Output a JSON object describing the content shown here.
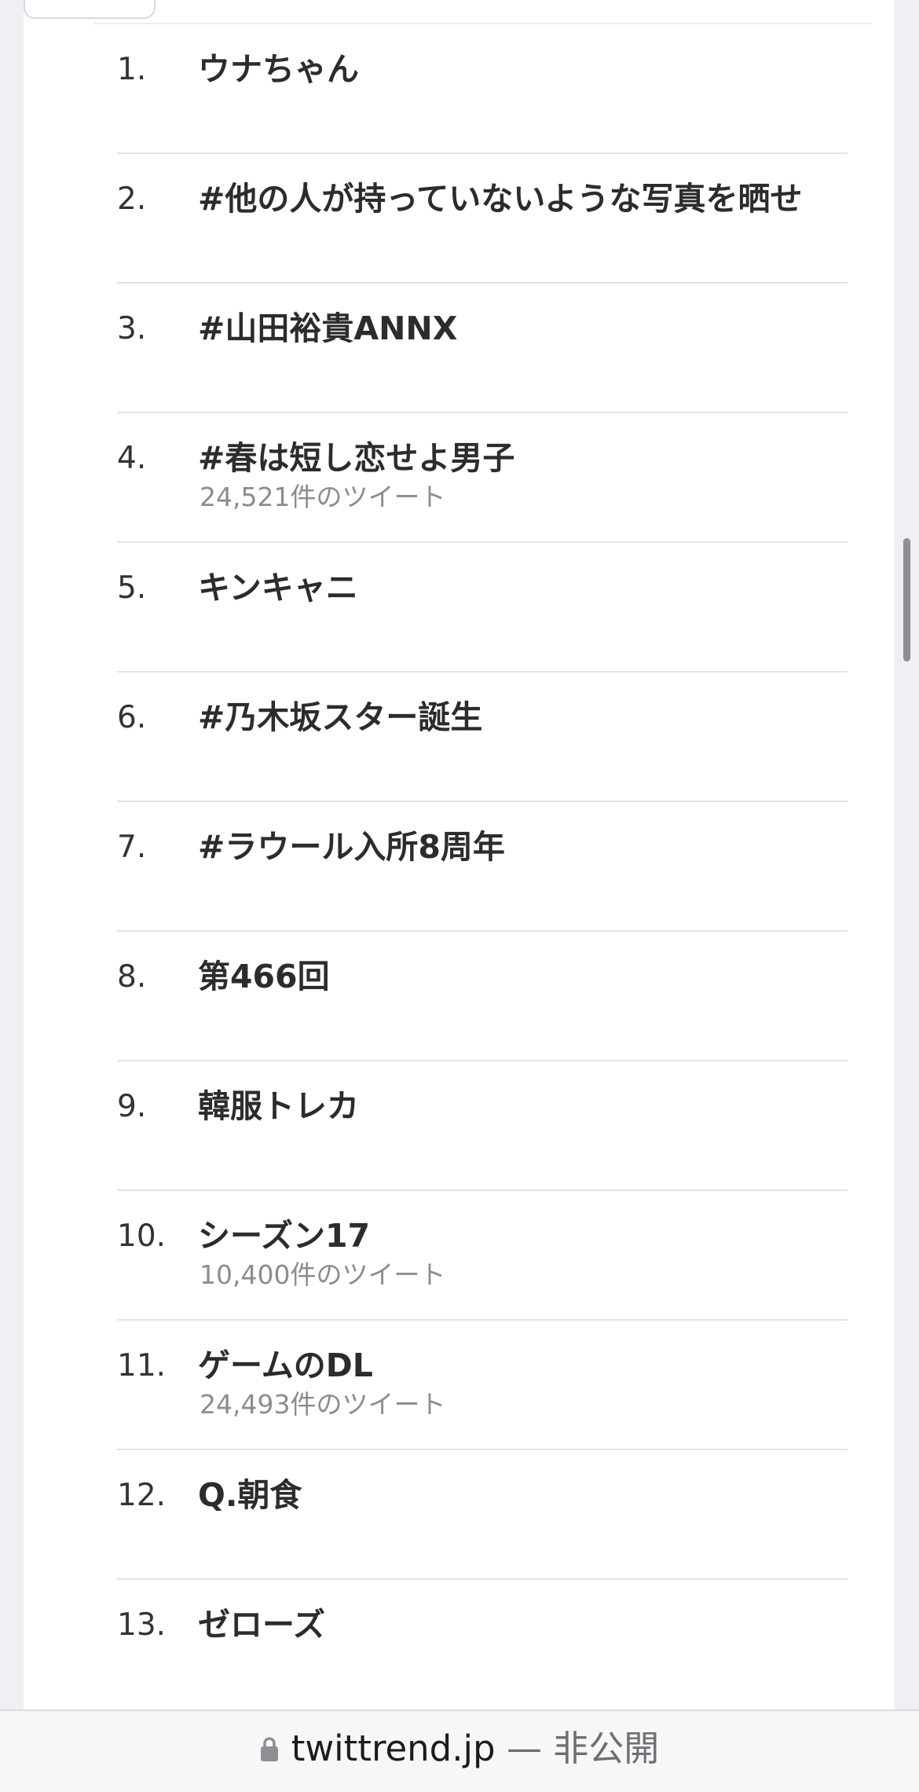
{
  "trends": [
    {
      "rank": "1.",
      "name": "ウナちゃん",
      "tweets": ""
    },
    {
      "rank": "2.",
      "name": "#他の人が持っていないような写真を晒せ",
      "tweets": ""
    },
    {
      "rank": "3.",
      "name": "#山田裕貴ANNX",
      "tweets": ""
    },
    {
      "rank": "4.",
      "name": "#春は短し恋せよ男子",
      "tweets": "24,521件のツイート"
    },
    {
      "rank": "5.",
      "name": "キンキャニ",
      "tweets": ""
    },
    {
      "rank": "6.",
      "name": "#乃木坂スター誕生",
      "tweets": ""
    },
    {
      "rank": "7.",
      "name": "#ラウール入所8周年",
      "tweets": ""
    },
    {
      "rank": "8.",
      "name": "第466回",
      "tweets": ""
    },
    {
      "rank": "9.",
      "name": "韓服トレカ",
      "tweets": ""
    },
    {
      "rank": "10.",
      "name": "シーズン17",
      "tweets": "10,400件のツイート"
    },
    {
      "rank": "11.",
      "name": "ゲームのDL",
      "tweets": "24,493件のツイート"
    },
    {
      "rank": "12.",
      "name": "Q.朝食",
      "tweets": ""
    },
    {
      "rank": "13.",
      "name": "ゼローズ",
      "tweets": ""
    }
  ],
  "address_bar": {
    "lock_icon": "lock-icon",
    "domain": "twittrend.jp",
    "separator": "—",
    "privacy_label": "非公開"
  }
}
